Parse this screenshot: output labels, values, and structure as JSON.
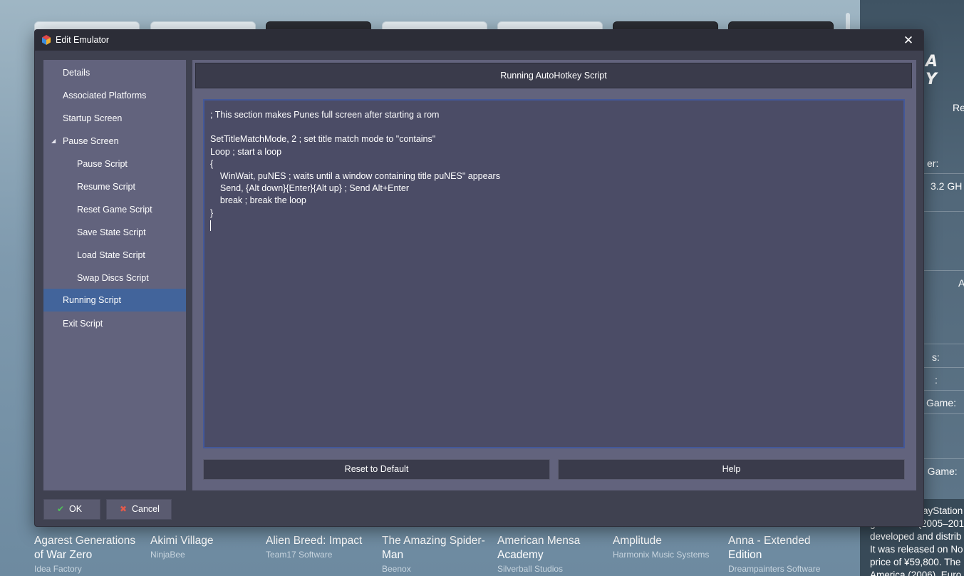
{
  "dialog": {
    "title": "Edit Emulator",
    "close_icon": "close-icon",
    "header": "Running AutoHotkey Script",
    "nav": [
      {
        "label": "Details",
        "level": 0,
        "active": false
      },
      {
        "label": "Associated Platforms",
        "level": 0,
        "active": false
      },
      {
        "label": "Startup Screen",
        "level": 0,
        "active": false
      },
      {
        "label": "Pause Screen",
        "level": 0,
        "active": false,
        "expanded": true
      },
      {
        "label": "Pause Script",
        "level": 1,
        "active": false
      },
      {
        "label": "Resume Script",
        "level": 1,
        "active": false
      },
      {
        "label": "Reset Game Script",
        "level": 1,
        "active": false
      },
      {
        "label": "Save State Script",
        "level": 1,
        "active": false
      },
      {
        "label": "Load State Script",
        "level": 1,
        "active": false
      },
      {
        "label": "Swap Discs Script",
        "level": 1,
        "active": false
      },
      {
        "label": "Running Script",
        "level": 0,
        "active": true
      },
      {
        "label": "Exit Script",
        "level": 0,
        "active": false
      }
    ],
    "script_lines": [
      "; This section makes Punes full screen after starting a rom",
      "",
      "SetTitleMatchMode, 2 ; set title match mode to \"contains\"",
      "Loop ; start a loop",
      "{",
      "    WinWait, puNES ; waits until a window containing title puNES\" appears",
      "    Send, {Alt down}{Enter}{Alt up} ; Send Alt+Enter",
      "    break ; break the loop",
      "}",
      ""
    ],
    "reset_label": "Reset to Default",
    "help_label": "Help",
    "ok_label": "OK",
    "cancel_label": "Cancel",
    "accent_color": "#42649b"
  },
  "background": {
    "games": [
      {
        "title_lines": [
          "Agarest Generations",
          "of War Zero"
        ],
        "developer": "Idea Factory"
      },
      {
        "title_lines": [
          "Akimi Village"
        ],
        "developer": "NinjaBee"
      },
      {
        "title_lines": [
          "Alien Breed: Impact"
        ],
        "developer": "Team17 Software"
      },
      {
        "title_lines": [
          "The Amazing Spider-",
          "Man"
        ],
        "developer": "Beenox"
      },
      {
        "title_lines": [
          "American Mensa",
          "Academy"
        ],
        "developer": "Silverball Studios"
      },
      {
        "title_lines": [
          "Amplitude"
        ],
        "developer": "Harmonix Music Systems"
      },
      {
        "title_lines": [
          "Anna - Extended",
          "Edition"
        ],
        "developer": "Dreampainters Software"
      }
    ],
    "right_panel": {
      "logo": "A Y",
      "texts": [
        "Re",
        "er:",
        "3.2 GH",
        "A",
        "s:",
        ":",
        "Game:",
        "d Game:"
      ],
      "description_lines": [
        "ayStation",
        "generation (2005–201",
        "developed and distrib",
        "It was released on No",
        "price of ¥59,800. The",
        "America (2006). Euro"
      ]
    }
  }
}
